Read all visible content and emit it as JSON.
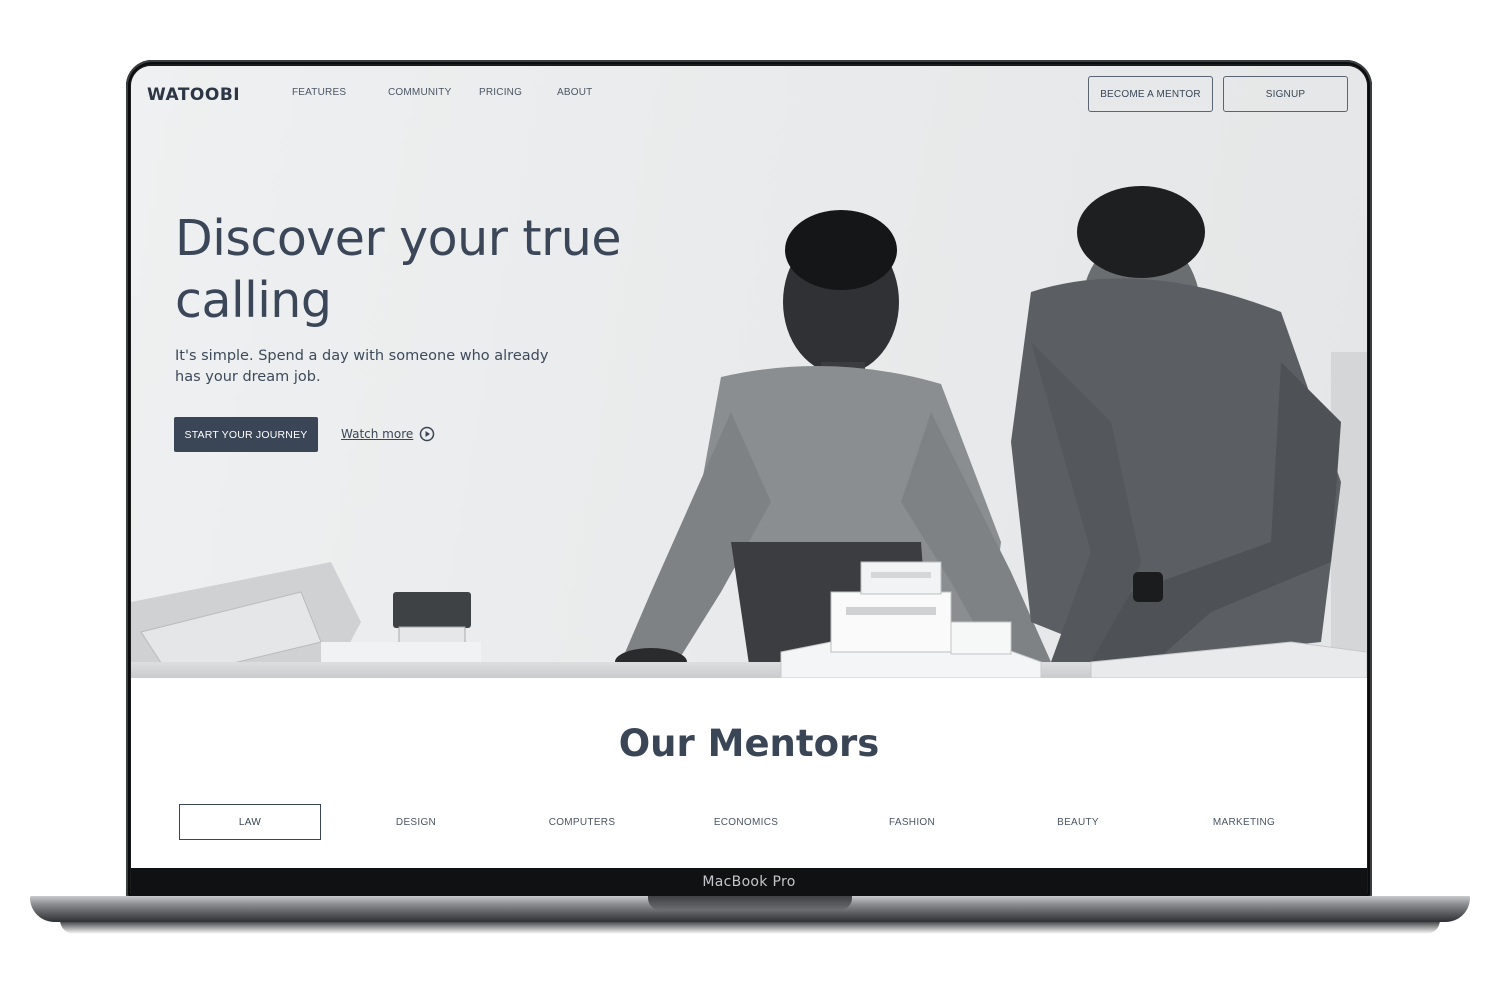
{
  "device": {
    "label": "MacBook Pro"
  },
  "nav": {
    "logo": "WATOOBI",
    "links": [
      "FEATURES",
      "COMMUNITY",
      "PRICING",
      "ABOUT"
    ],
    "become_mentor": "BECOME A MENTOR",
    "signup": "SIGNUP"
  },
  "hero": {
    "headline_line1": "Discover your true",
    "headline_line2": "calling",
    "subtext": "It's simple. Spend a day with someone who already has your dream job.",
    "cta": "START YOUR JOURNEY",
    "watch_more": "Watch more"
  },
  "mentors": {
    "title": "Our Mentors",
    "tabs": [
      "LAW",
      "DESIGN",
      "COMPUTERS",
      "ECONOMICS",
      "FASHION",
      "BEAUTY",
      "MARKETING"
    ],
    "active_tab": "LAW"
  },
  "colors": {
    "primary": "#3a4656",
    "hero_bg": "#eceeef",
    "bezel": "#1a1b1d"
  }
}
